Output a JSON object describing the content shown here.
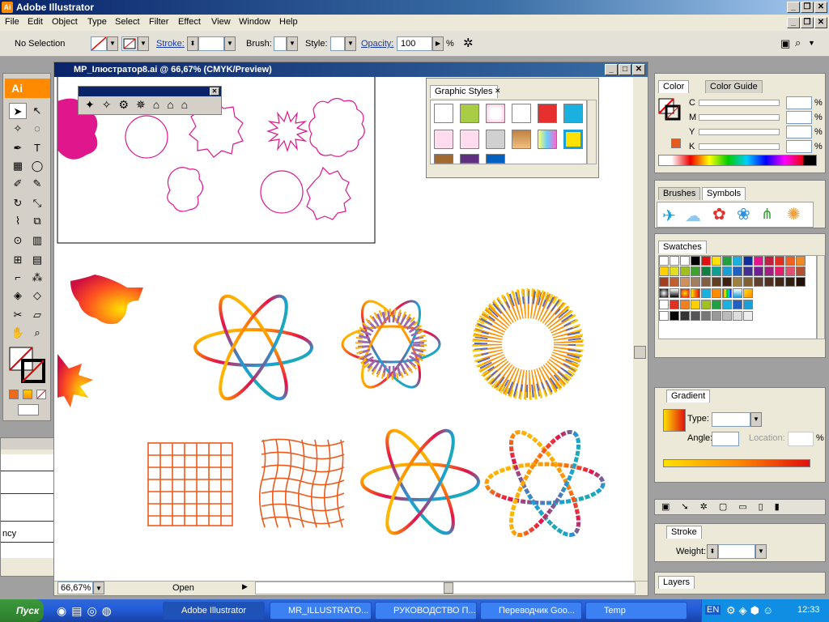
{
  "app": {
    "title": "Adobe Illustrator",
    "logo": "Ai"
  },
  "menu": [
    "File",
    "Edit",
    "Object",
    "Type",
    "Select",
    "Filter",
    "Effect",
    "View",
    "Window",
    "Help"
  ],
  "control_bar": {
    "selection": "No Selection",
    "stroke_label": "Stroke:",
    "brush_label": "Brush:",
    "style_label": "Style:",
    "opacity_label": "Opacity:",
    "opacity_value": "100",
    "opacity_unit": "%"
  },
  "document": {
    "title": "MP_Ілюстратор8.ai @ 66,67% (CMYK/Preview)",
    "zoom": "66,67%",
    "status": "Open"
  },
  "graphic_styles": {
    "tab": "Graphic Styles"
  },
  "color_panel": {
    "tab_color": "Color",
    "tab_guide": "Color Guide",
    "channels": [
      "C",
      "M",
      "Y",
      "K"
    ],
    "unit": "%",
    "k_swatch": "#e85a1a"
  },
  "brushes_panel": {
    "tab_brushes": "Brushes",
    "tab_symbols": "Symbols"
  },
  "swatches_panel": {
    "tab": "Swatches"
  },
  "gradient_panel": {
    "tab": "Gradient",
    "type_label": "Type:",
    "angle_label": "Angle:",
    "location_label": "Location:",
    "unit": "%"
  },
  "stroke_panel": {
    "tab": "Stroke",
    "weight_label": "Weight:"
  },
  "layers_panel": {
    "tab": "Layers"
  },
  "left_panel": {
    "item": "ncy"
  },
  "taskbar": {
    "start": "Пуск",
    "tasks": [
      "Adobe Illustrator",
      "MR_ILLUSTRATO...",
      "РУКОВОДСТВО П...",
      "Переводчик Goo...",
      "Temp"
    ],
    "lang": "EN",
    "clock": "12:33"
  },
  "colors": {
    "accent": "#ff8a00",
    "title_blue": "#0a246a",
    "magenta": "#e0168c"
  }
}
